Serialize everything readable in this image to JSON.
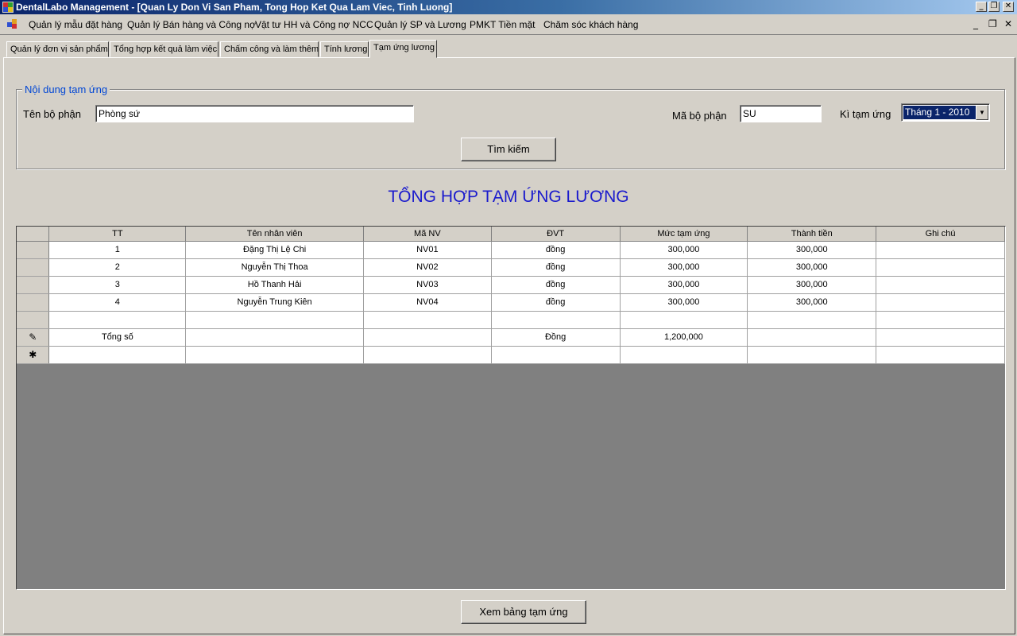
{
  "window": {
    "title": "DentalLabo Management - [Quan Ly Don Vi San Pham, Tong Hop Ket Qua Lam Viec, Tinh Luong]"
  },
  "menu": {
    "items": [
      "Quản lý mẫu đặt hàng",
      "Quản lý Bán hàng và Công nợ",
      "Vật tư HH và Công nợ NCC",
      "Quản lý SP và Lương",
      "PMKT Tiền mặt",
      "Chăm sóc khách hàng"
    ]
  },
  "tabs": [
    "Quản lý đơn vị sản phẩm",
    "Tổng hợp kết quả làm việc",
    "Chấm công và làm thêm",
    "Tính lương",
    "Tạm ứng lương"
  ],
  "active_tab": "Tạm ứng lương",
  "group": {
    "legend": "Nội dung tạm ứng",
    "dept_name_label": "Tên bộ phận",
    "dept_name_value": "Phòng sứ",
    "dept_code_label": "Mã bộ phận",
    "dept_code_value": "SU",
    "period_label": "Kì tạm ứng",
    "period_value": "Tháng 1 - 2010",
    "search_button": "Tìm kiếm"
  },
  "report_title": "TỔNG HỢP TẠM ỨNG LƯƠNG",
  "grid": {
    "columns": [
      "TT",
      "Tên nhân viên",
      "Mã NV",
      "ĐVT",
      "Mức tạm ứng",
      "Thành tiền",
      "Ghi chú"
    ],
    "rows": [
      {
        "tt": "1",
        "name": "Đặng Thị Lệ Chi",
        "code": "NV01",
        "unit": "đồng",
        "advance": "300,000",
        "amount": "300,000",
        "note": ""
      },
      {
        "tt": "2",
        "name": "Nguyễn Thị Thoa",
        "code": "NV02",
        "unit": "đồng",
        "advance": "300,000",
        "amount": "300,000",
        "note": ""
      },
      {
        "tt": "3",
        "name": "Hồ Thanh Hải",
        "code": "NV03",
        "unit": "đồng",
        "advance": "300,000",
        "amount": "300,000",
        "note": ""
      },
      {
        "tt": "4",
        "name": "Nguyễn Trung Kiên",
        "code": "NV04",
        "unit": "đồng",
        "advance": "300,000",
        "amount": "300,000",
        "note": ""
      }
    ],
    "total": {
      "label": "Tổng số",
      "unit": "Đồng",
      "advance": "1,200,000"
    },
    "edit_marker": "✎",
    "new_row_marker": "✱"
  },
  "view_button": "Xem bảng tạm ứng"
}
